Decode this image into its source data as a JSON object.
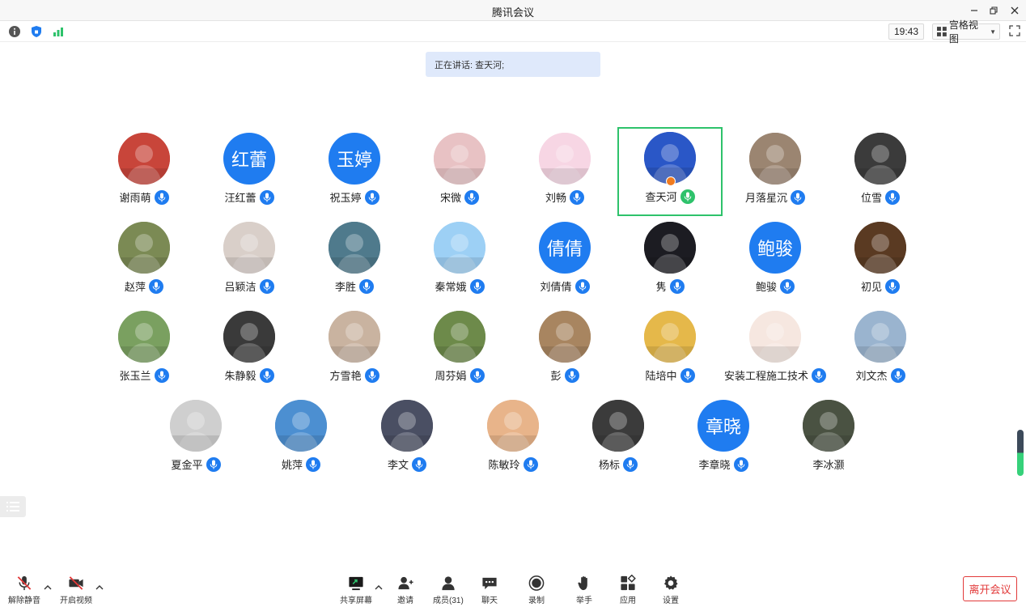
{
  "window": {
    "title": "腾讯会议"
  },
  "infobar": {
    "time": "19:43",
    "view_label": "宫格视图"
  },
  "speaking": {
    "text": "正在讲话: 查天河;"
  },
  "participants": [
    {
      "name": "谢雨萌",
      "avatar_text": "",
      "bg": "#c8453a"
    },
    {
      "name": "汪红蕾",
      "avatar_text": "红蕾",
      "bg": "#1f7cf0"
    },
    {
      "name": "祝玉婷",
      "avatar_text": "玉婷",
      "bg": "#1f7cf0"
    },
    {
      "name": "宋微",
      "avatar_text": "",
      "bg": "#e8c2c4"
    },
    {
      "name": "刘畅",
      "avatar_text": "",
      "bg": "#f7d6e4"
    },
    {
      "name": "查天河",
      "avatar_text": "",
      "bg": "#2a57c7"
    },
    {
      "name": "月落星沉",
      "avatar_text": "",
      "bg": "#9b8571"
    },
    {
      "name": "位雪",
      "avatar_text": "",
      "bg": "#3b3b3b"
    },
    {
      "name": "赵萍",
      "avatar_text": "",
      "bg": "#7b8a54"
    },
    {
      "name": "吕颖洁",
      "avatar_text": "",
      "bg": "#d9cfc9"
    },
    {
      "name": "李胜",
      "avatar_text": "",
      "bg": "#4f7a8c"
    },
    {
      "name": "秦常娥",
      "avatar_text": "",
      "bg": "#9dd0f5"
    },
    {
      "name": "刘倩倩",
      "avatar_text": "倩倩",
      "bg": "#1f7cf0"
    },
    {
      "name": "隽",
      "avatar_text": "",
      "bg": "#1c1c22"
    },
    {
      "name": "鲍骏",
      "avatar_text": "鲍骏",
      "bg": "#1f7cf0"
    },
    {
      "name": "初见",
      "avatar_text": "",
      "bg": "#5a3a22"
    },
    {
      "name": "张玉兰",
      "avatar_text": "",
      "bg": "#7aa060"
    },
    {
      "name": "朱静毅",
      "avatar_text": "",
      "bg": "#3a3a3a"
    },
    {
      "name": "方雪艳",
      "avatar_text": "",
      "bg": "#c9b3a0"
    },
    {
      "name": "周芬娟",
      "avatar_text": "",
      "bg": "#6d8a4a"
    },
    {
      "name": "彭",
      "avatar_text": "",
      "bg": "#a88560"
    },
    {
      "name": "陆培中",
      "avatar_text": "",
      "bg": "#e5b84a"
    },
    {
      "name": "安装工程施工技术",
      "avatar_text": "",
      "bg": "#f6e7e0"
    },
    {
      "name": "刘文杰",
      "avatar_text": "",
      "bg": "#9ab4cf"
    },
    {
      "name": "夏金平",
      "avatar_text": "",
      "bg": "#cfcfcf"
    },
    {
      "name": "姚萍",
      "avatar_text": "",
      "bg": "#4c8fd1"
    },
    {
      "name": "李文",
      "avatar_text": "",
      "bg": "#4a4f63"
    },
    {
      "name": "陈敏玲",
      "avatar_text": "",
      "bg": "#e8b48a"
    },
    {
      "name": "杨标",
      "avatar_text": "",
      "bg": "#3b3b3b"
    },
    {
      "name": "李章晓",
      "avatar_text": "章晓",
      "bg": "#1f7cf0"
    },
    {
      "name": "李冰灏",
      "avatar_text": "",
      "bg": "#4a5242"
    }
  ],
  "toolbar": {
    "mute": "解除静音",
    "video": "开启视频",
    "share": "共享屏幕",
    "invite": "邀请",
    "members": "成员(31)",
    "chat": "聊天",
    "record": "录制",
    "raise_hand": "举手",
    "apps": "应用",
    "settings": "设置",
    "leave": "离开会议"
  }
}
